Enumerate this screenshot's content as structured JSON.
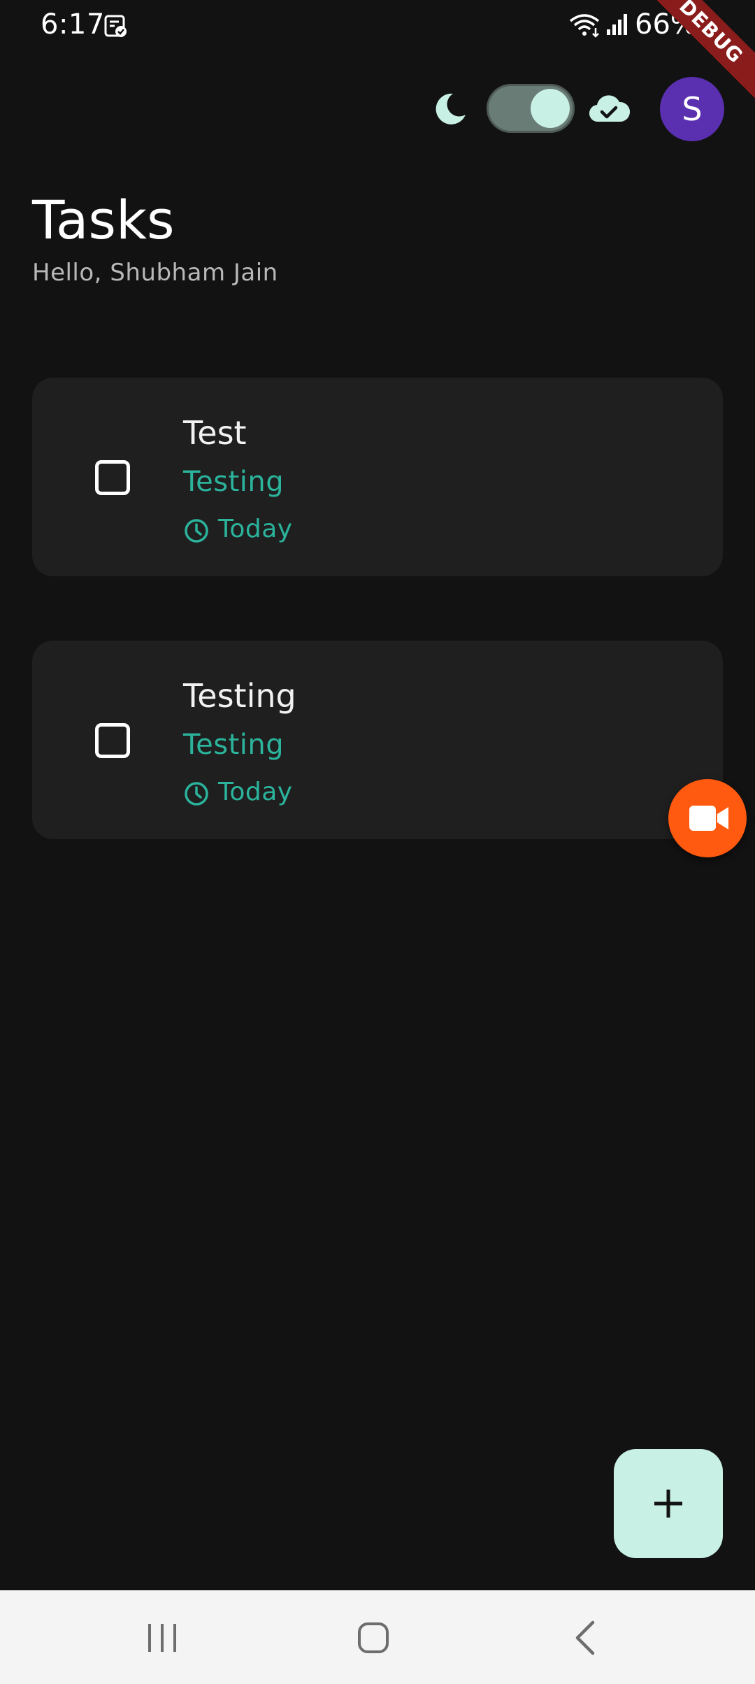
{
  "status_bar": {
    "time": "6:17",
    "battery": "66%",
    "note_icon": "clipboard-check-icon",
    "wifi_icon": "wifi-icon",
    "signal_icon": "signal-icon",
    "battery_icon": "battery-icon"
  },
  "debug_banner": "DEBUG",
  "toolbar": {
    "theme_icon": "moon-icon",
    "theme_toggle_on": true,
    "sync_icon": "cloud-check-icon",
    "avatar_initial": "S"
  },
  "header": {
    "title": "Tasks",
    "greeting": "Hello, Shubham Jain"
  },
  "tasks": [
    {
      "title": "Test",
      "description": "Testing",
      "due": "Today",
      "completed": false
    },
    {
      "title": "Testing",
      "description": "Testing",
      "due": "Today",
      "completed": false
    }
  ],
  "fab": {
    "icon": "plus-icon"
  },
  "record_button": {
    "icon": "video-camera-icon"
  },
  "nav_bar": {
    "recents_icon": "recents-icon",
    "home_icon": "home-icon",
    "back_icon": "back-icon"
  },
  "colors": {
    "background": "#121212",
    "card": "#1f1f1f",
    "accent": "#2bb39c",
    "mint": "#c8f0e4",
    "avatar": "#5a2fb0",
    "record": "#ff5a0f",
    "debug": "#8a1c1c"
  }
}
